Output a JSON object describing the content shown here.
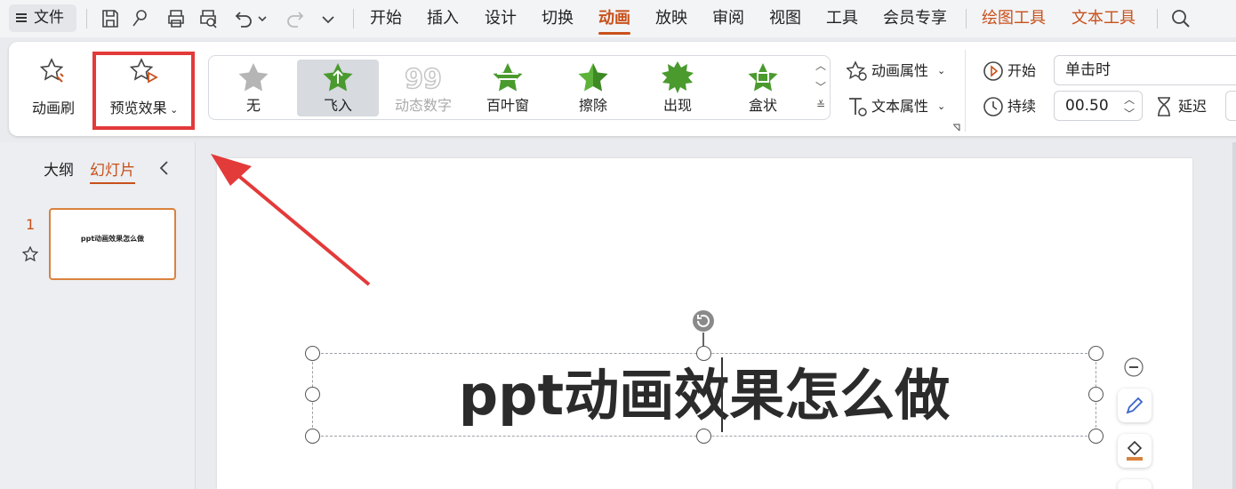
{
  "menubar": {
    "file_label": "文件",
    "tabs": [
      "开始",
      "插入",
      "设计",
      "切换",
      "动画",
      "放映",
      "审阅",
      "视图",
      "工具",
      "会员专享"
    ],
    "active_tab": "动画",
    "context_tabs": [
      "绘图工具",
      "文本工具"
    ],
    "quick_icons": [
      "save-icon",
      "format-painter-icon",
      "print-icon",
      "print-preview-icon",
      "undo-icon",
      "redo-icon",
      "more-icon"
    ]
  },
  "ribbon": {
    "animation_painter": "动画刷",
    "preview": "预览效果",
    "gallery": [
      {
        "label": "无",
        "state": "normal"
      },
      {
        "label": "飞入",
        "state": "selected"
      },
      {
        "label": "动态数字",
        "state": "disabled"
      },
      {
        "label": "百叶窗",
        "state": "normal"
      },
      {
        "label": "擦除",
        "state": "normal"
      },
      {
        "label": "出现",
        "state": "normal"
      },
      {
        "label": "盒状",
        "state": "normal"
      }
    ],
    "animation_props": "动画属性",
    "text_props": "文本属性",
    "start_label": "开始",
    "start_value": "单击时",
    "duration_label": "持续",
    "duration_value": "00.50",
    "delay_label": "延迟"
  },
  "left_panel": {
    "tab_outline": "大纲",
    "tab_slides": "幻灯片",
    "slide_number": "1",
    "thumb_text": "ppt动画效果怎么做"
  },
  "slide": {
    "title": "ppt动画效果怎么做"
  },
  "colors": {
    "accent": "#c8511b",
    "highlight_box": "#e33a3a",
    "star_green": "#4a9a2e"
  }
}
